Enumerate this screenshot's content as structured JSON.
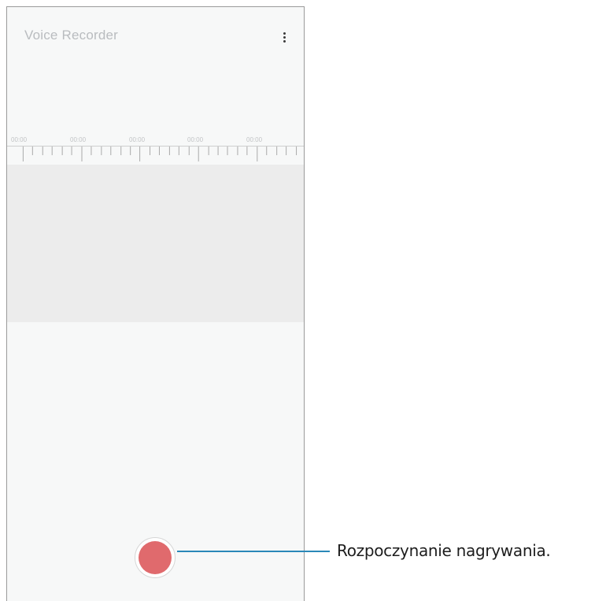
{
  "app": {
    "title": "Voice Recorder",
    "more_icon": "more-vertical-icon"
  },
  "timeline": {
    "labels": [
      "00:00",
      "00:00",
      "00:00",
      "00:00",
      "00:00"
    ]
  },
  "record": {
    "icon": "record-icon",
    "color": "#e06a6d"
  },
  "callout": {
    "text": "Rozpoczynanie nagrywania.",
    "line_color": "#2a88b8"
  }
}
